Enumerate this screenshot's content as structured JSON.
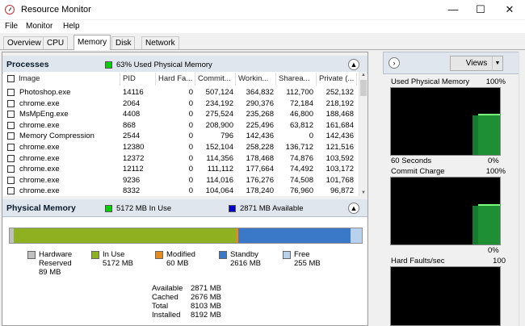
{
  "window": {
    "title": "Resource Monitor",
    "minimize": "—",
    "maximize": "☐",
    "close": "✕"
  },
  "menu": [
    "File",
    "Monitor",
    "Help"
  ],
  "tabs": [
    {
      "label": "Overview",
      "active": false
    },
    {
      "label": "CPU",
      "active": false
    },
    {
      "label": "Memory",
      "active": true
    },
    {
      "label": "Disk",
      "active": false
    },
    {
      "label": "Network",
      "active": false
    }
  ],
  "processes": {
    "title": "Processes",
    "status": "63% Used Physical Memory",
    "status_color": "#00d000",
    "columns": [
      "Image",
      "PID",
      "Hard Fa...",
      "Commit...",
      "Workin...",
      "Sharea...",
      "Private (..."
    ],
    "rows": [
      [
        "Photoshop.exe",
        "14116",
        "0",
        "507,124",
        "364,832",
        "112,700",
        "252,132"
      ],
      [
        "chrome.exe",
        "2064",
        "0",
        "234,192",
        "290,376",
        "72,184",
        "218,192"
      ],
      [
        "MsMpEng.exe",
        "4408",
        "0",
        "275,524",
        "235,268",
        "46,800",
        "188,468"
      ],
      [
        "chrome.exe",
        "868",
        "0",
        "208,900",
        "225,496",
        "63,812",
        "161,684"
      ],
      [
        "Memory Compression",
        "2544",
        "0",
        "796",
        "142,436",
        "0",
        "142,436"
      ],
      [
        "chrome.exe",
        "12380",
        "0",
        "152,104",
        "258,228",
        "136,712",
        "121,516"
      ],
      [
        "chrome.exe",
        "12372",
        "0",
        "114,356",
        "178,468",
        "74,876",
        "103,592"
      ],
      [
        "chrome.exe",
        "12112",
        "0",
        "111,112",
        "177,664",
        "74,492",
        "103,172"
      ],
      [
        "chrome.exe",
        "9236",
        "0",
        "114,016",
        "176,276",
        "74,508",
        "101,768"
      ],
      [
        "chrome.exe",
        "8332",
        "0",
        "104,064",
        "178,240",
        "76,960",
        "96,872"
      ]
    ]
  },
  "physical_memory": {
    "title": "Physical Memory",
    "in_use_status": "5172 MB In Use",
    "available_status": "2871 MB Available",
    "in_use_color": "#00d000",
    "available_color": "#0000c8",
    "bar": [
      {
        "name": "Hardware Reserved",
        "mb": 89,
        "color": "#c0c0c0"
      },
      {
        "name": "In Use",
        "mb": 5172,
        "color": "#8fb021"
      },
      {
        "name": "Modified",
        "mb": 60,
        "color": "#e88a1a"
      },
      {
        "name": "Standby",
        "mb": 2616,
        "color": "#3a78c8"
      },
      {
        "name": "Free",
        "mb": 255,
        "color": "#b8d2ee"
      }
    ],
    "legend": [
      {
        "label": "Hardware",
        "label2": "Reserved",
        "value": "89 MB",
        "color": "#c0c0c0"
      },
      {
        "label": "In Use",
        "label2": "",
        "value": "5172 MB",
        "color": "#8fb021"
      },
      {
        "label": "Modified",
        "label2": "",
        "value": "60 MB",
        "color": "#e88a1a"
      },
      {
        "label": "Standby",
        "label2": "",
        "value": "2616 MB",
        "color": "#3a78c8"
      },
      {
        "label": "Free",
        "label2": "",
        "value": "255 MB",
        "color": "#b8d2ee"
      }
    ],
    "summary": [
      {
        "label": "Available",
        "value": "2871 MB"
      },
      {
        "label": "Cached",
        "value": "2676 MB"
      },
      {
        "label": "Total",
        "value": "8103 MB"
      },
      {
        "label": "Installed",
        "value": "8192 MB"
      }
    ]
  },
  "side_panel": {
    "expand_glyph": "›",
    "views_label": "Views",
    "views_dropdown": "▼",
    "graphs": [
      {
        "title": "Used Physical Memory",
        "max": "100%",
        "bottom_left": "60 Seconds",
        "bottom_right": "0%",
        "level_pct": 62
      },
      {
        "title": "Commit Charge",
        "max": "100%",
        "bottom_left": "",
        "bottom_right": "0%",
        "level_pct": 60
      },
      {
        "title": "Hard Faults/sec",
        "max": "100",
        "bottom_left": "",
        "bottom_right": "",
        "level_pct": 0
      }
    ]
  }
}
